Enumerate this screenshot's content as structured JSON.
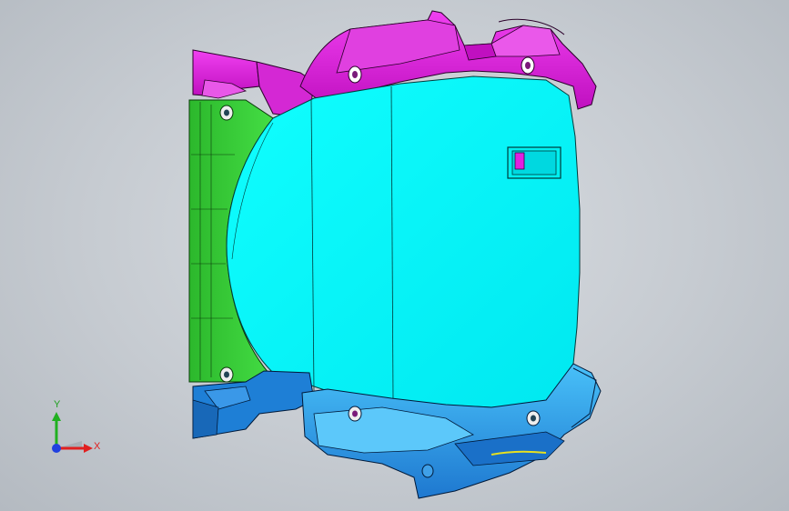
{
  "viewport": {
    "background_top": "#d9dde2",
    "background_bottom": "#b4bac1"
  },
  "model": {
    "parts": [
      {
        "name": "cyan-panel",
        "color": "#00ffff"
      },
      {
        "name": "magenta-bracket",
        "color": "#e020e0"
      },
      {
        "name": "green-frame",
        "color": "#33cc33"
      },
      {
        "name": "blue-bracket",
        "color": "#1e7fd6"
      },
      {
        "name": "light-blue-bracket",
        "color": "#3fb8f5"
      }
    ]
  },
  "triad": {
    "x_label": "X",
    "y_label": "Y",
    "x_color": "#e02020",
    "y_color": "#20b020",
    "origin_color": "#2040e0"
  }
}
